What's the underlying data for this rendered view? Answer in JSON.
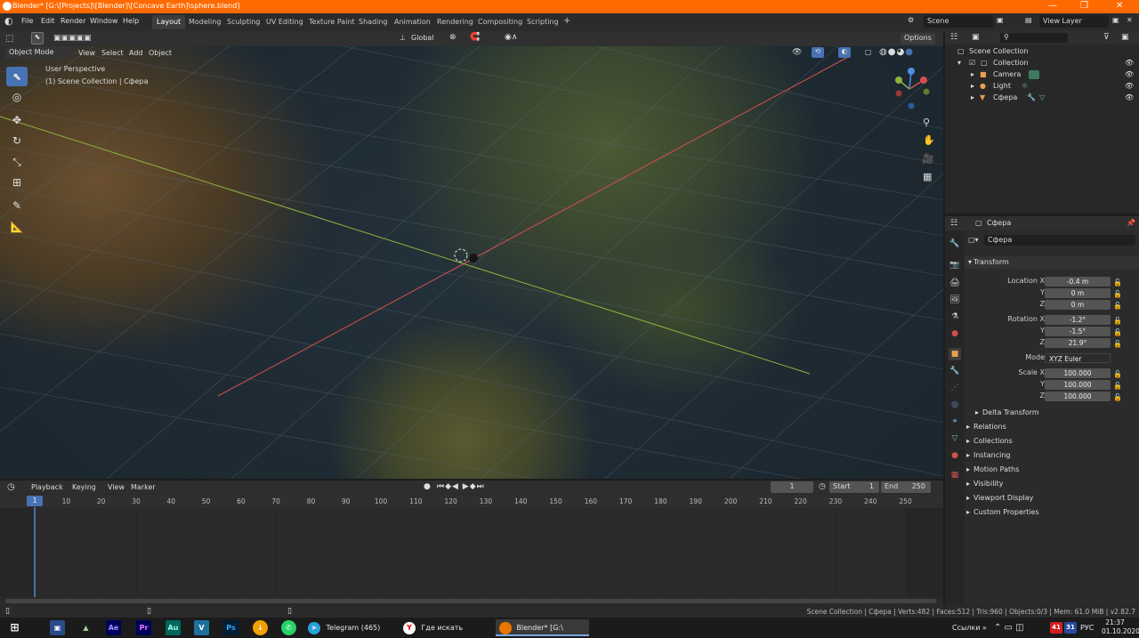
{
  "window": {
    "title": "Blender* [G:\\[Projects]\\[Blender]\\[Concave Earth]\\sphere.blend]"
  },
  "menu": [
    "File",
    "Edit",
    "Render",
    "Window",
    "Help"
  ],
  "workspaces": [
    "Layout",
    "Modeling",
    "Sculpting",
    "UV Editing",
    "Texture Paint",
    "Shading",
    "Animation",
    "Rendering",
    "Compositing",
    "Scripting",
    "+"
  ],
  "scene": {
    "name": "Scene",
    "view_layer": "View Layer"
  },
  "viewport": {
    "mode": "Object Mode",
    "menus": [
      "View",
      "Select",
      "Add",
      "Object"
    ],
    "orientation": "Global",
    "options_label": "Options",
    "overlay_title": "User Perspective",
    "overlay_sub": "(1) Scene Collection | Сфера"
  },
  "outliner": {
    "root": "Scene Collection",
    "collection": "Collection",
    "items": [
      "Camera",
      "Light",
      "Сфера"
    ]
  },
  "properties": {
    "object_name": "Сфера",
    "datablock_name": "Сфера",
    "transform_label": "Transform",
    "location_label": "Location X",
    "rotation_label": "Rotation X",
    "scale_label": "Scale X",
    "mode_label": "Mode",
    "y_label": "Y",
    "z_label": "Z",
    "location": [
      "-0.4 m",
      "0 m",
      "0 m"
    ],
    "rotation": [
      "-1.2°",
      "-1.5°",
      "21.9°"
    ],
    "rotation_mode": "XYZ Euler",
    "scale": [
      "100.000",
      "100.000",
      "100.000"
    ],
    "delta_transform": "Delta Transform",
    "panels": [
      "Relations",
      "Collections",
      "Instancing",
      "Motion Paths",
      "Visibility",
      "Viewport Display",
      "Custom Properties"
    ]
  },
  "timeline": {
    "menus": [
      "Playback",
      "Keying",
      "View",
      "Marker"
    ],
    "current_frame": "1",
    "start_label": "Start",
    "start": "1",
    "end_label": "End",
    "end": "250",
    "ticks": [
      "10",
      "20",
      "30",
      "40",
      "50",
      "60",
      "70",
      "80",
      "90",
      "100",
      "110",
      "120",
      "130",
      "140",
      "150",
      "160",
      "170",
      "180",
      "190",
      "200",
      "210",
      "220",
      "230",
      "240",
      "250"
    ],
    "playhead_label": "1"
  },
  "status": "Scene Collection | Сфера | Verts:482 | Faces:512 | Tris:960 | Objects:0/3 | Mem: 61.0 MiB | v2.82.7",
  "taskbar": {
    "apps": [
      {
        "icon": "Ae",
        "color": "#00005b"
      },
      {
        "icon": "Pr",
        "color": "#00005b"
      },
      {
        "icon": "Au",
        "color": "#00675b"
      },
      {
        "icon": "V",
        "color": "#1f6f9f"
      },
      {
        "icon": "Ps",
        "color": "#001e36"
      }
    ],
    "windows": [
      "Telegram (465)",
      "Где искать творче...",
      "Blender* [G:\\[Proje..."
    ],
    "tray_label": "Ссылки",
    "badges": [
      "41",
      "31"
    ],
    "lang": "РУС",
    "time": "21:37",
    "date": "01.10.2020"
  }
}
